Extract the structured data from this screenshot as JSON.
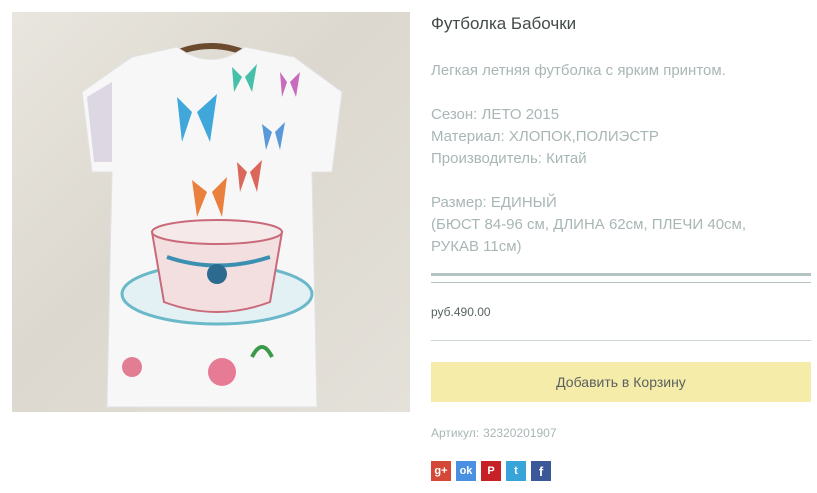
{
  "product": {
    "title": "Футболка Бабочки",
    "description": "Легкая летняя футболка с ярким принтом.",
    "season": "Сезон: ЛЕТО 2015",
    "material": "Материал: ХЛОПОК,ПОЛИЭСТР",
    "manufacturer": "Производитель: Китай",
    "size": "Размер: ЕДИНЫЙ",
    "size_details_line1": "(БЮСТ 84-96 см, ДЛИНА 62см, ПЛЕЧИ 40см,",
    "size_details_line2": "РУКАВ 11см)",
    "price": "руб.490.00",
    "add_to_cart_label": "Добавить в Корзину",
    "sku_label": "Артикул:",
    "sku_value": "32320201907"
  },
  "social": [
    {
      "icon": "google-plus-icon",
      "glyph": "g+",
      "color": "#d34836"
    },
    {
      "icon": "odnoklassniki-icon",
      "glyph": "ok",
      "color": "#4a90e2"
    },
    {
      "icon": "pinterest-icon",
      "glyph": "P",
      "color": "#c62127"
    },
    {
      "icon": "twitter-icon",
      "glyph": "t",
      "color": "#39a4d8"
    },
    {
      "icon": "facebook-icon",
      "glyph": "f",
      "color": "#3b5998"
    }
  ],
  "colors": {
    "button_bg": "#f5ecaa",
    "muted_text": "#a9b6b6",
    "rule": "#b4c2c2"
  }
}
